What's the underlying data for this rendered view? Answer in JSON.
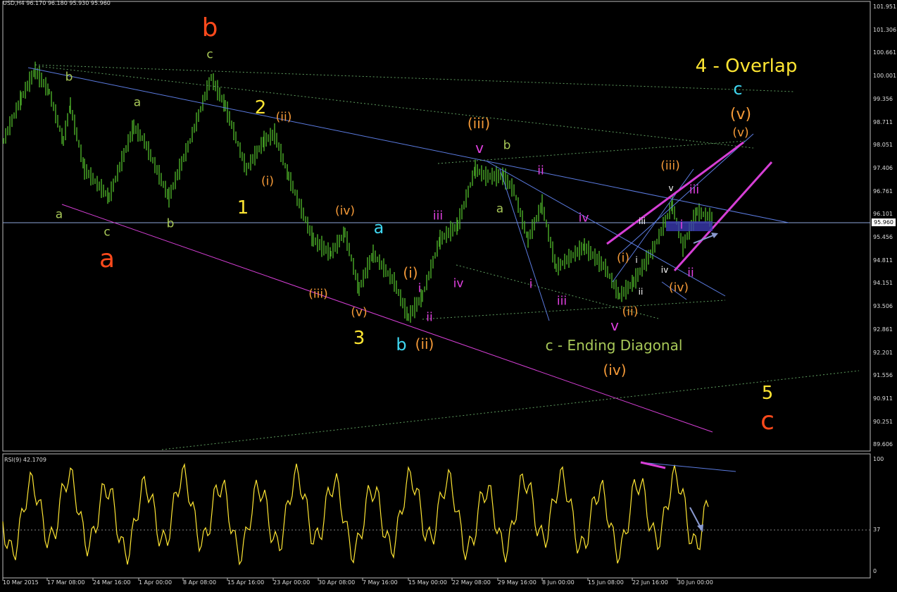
{
  "header": {
    "symbol_info": "USD,H4  96.170 96.180 95.930 95.960"
  },
  "current_price": "95.960",
  "price_axis": [
    "101.951",
    "101.306",
    "100.661",
    "100.001",
    "99.356",
    "98.711",
    "98.051",
    "97.406",
    "96.761",
    "96.101",
    "95.456",
    "94.811",
    "94.151",
    "93.506",
    "92.861",
    "92.201",
    "91.556",
    "90.911",
    "90.251",
    "89.606"
  ],
  "time_axis": [
    "10 Mar 2015",
    "17 Mar 08:00",
    "24 Mar 16:00",
    "1 Apr 00:00",
    "8 Apr 08:00",
    "15 Apr 16:00",
    "23 Apr 00:00",
    "30 Apr 08:00",
    "7 May 16:00",
    "15 May 00:00",
    "22 May 08:00",
    "29 May 16:00",
    "8 Jun 00:00",
    "15 Jun 08:00",
    "22 Jun 16:00",
    "30 Jun 00:00"
  ],
  "rsi": {
    "label": "RSI(9) 42.1709",
    "levels": [
      "100",
      "37",
      "0"
    ]
  },
  "colors": {
    "background": "#000000",
    "candles": "#4CAF28",
    "trend_blue": "#5B7BE0",
    "trend_magenta": "#D63FD6",
    "dotted_green": "#5E9C5E",
    "rsi_line": "#FFE633",
    "red": "#FF4A1C",
    "orange": "#F59A38",
    "yellow": "#FFE633",
    "cyan": "#3FD6F0",
    "pink": "#E040E0",
    "olive": "#A8C858",
    "white": "#FFFFFF"
  },
  "labels": [
    {
      "text": "b",
      "color": "red",
      "size": 36
    },
    {
      "text": "a",
      "color": "red",
      "size": 36
    },
    {
      "text": "c",
      "color": "red",
      "size": 36
    },
    {
      "text": "c",
      "color": "olive",
      "size": 17
    },
    {
      "text": "b",
      "color": "olive",
      "size": 17
    },
    {
      "text": "a",
      "color": "olive",
      "size": 17
    },
    {
      "text": "a",
      "color": "olive",
      "size": 17
    },
    {
      "text": "c",
      "color": "olive",
      "size": 17
    },
    {
      "text": "b",
      "color": "olive",
      "size": 17
    },
    {
      "text": "b",
      "color": "olive",
      "size": 17
    },
    {
      "text": "a",
      "color": "olive",
      "size": 17
    },
    {
      "text": "2",
      "color": "yellow",
      "size": 26
    },
    {
      "text": "1",
      "color": "yellow",
      "size": 26
    },
    {
      "text": "3",
      "color": "yellow",
      "size": 26
    },
    {
      "text": "5",
      "color": "yellow",
      "size": 26
    },
    {
      "text": "4 - Overlap",
      "color": "yellow",
      "size": 26
    },
    {
      "text": "a",
      "color": "cyan",
      "size": 24
    },
    {
      "text": "b",
      "color": "cyan",
      "size": 24
    },
    {
      "text": "c",
      "color": "cyan",
      "size": 24
    },
    {
      "text": "(ii)",
      "color": "orange",
      "size": 17
    },
    {
      "text": "(i)",
      "color": "orange",
      "size": 17
    },
    {
      "text": "(iv)",
      "color": "orange",
      "size": 17
    },
    {
      "text": "(iii)",
      "color": "orange",
      "size": 17
    },
    {
      "text": "(v)",
      "color": "orange",
      "size": 17
    },
    {
      "text": "(i)",
      "color": "orange",
      "size": 20
    },
    {
      "text": "(ii)",
      "color": "orange",
      "size": 20
    },
    {
      "text": "(iii)",
      "color": "orange",
      "size": 20
    },
    {
      "text": "(iv)",
      "color": "orange",
      "size": 20
    },
    {
      "text": "(v)",
      "color": "orange",
      "size": 22
    },
    {
      "text": "(v)",
      "color": "orange",
      "size": 17
    },
    {
      "text": "(iii)",
      "color": "orange",
      "size": 17
    },
    {
      "text": "(i)",
      "color": "orange",
      "size": 17
    },
    {
      "text": "(ii)",
      "color": "orange",
      "size": 17
    },
    {
      "text": "(iv)",
      "color": "orange",
      "size": 17
    },
    {
      "text": "iii",
      "color": "pink",
      "size": 17
    },
    {
      "text": "iv",
      "color": "pink",
      "size": 17
    },
    {
      "text": "i",
      "color": "pink",
      "size": 17
    },
    {
      "text": "ii",
      "color": "pink",
      "size": 17
    },
    {
      "text": "v",
      "color": "pink",
      "size": 20
    },
    {
      "text": "ii",
      "color": "pink",
      "size": 17
    },
    {
      "text": "iv",
      "color": "pink",
      "size": 17
    },
    {
      "text": "i",
      "color": "pink",
      "size": 17
    },
    {
      "text": "iii",
      "color": "pink",
      "size": 17
    },
    {
      "text": "v",
      "color": "pink",
      "size": 20
    },
    {
      "text": "iii",
      "color": "pink",
      "size": 17
    },
    {
      "text": "i",
      "color": "pink",
      "size": 17
    },
    {
      "text": "ii",
      "color": "pink",
      "size": 17
    },
    {
      "text": "iii",
      "color": "white",
      "size": 12
    },
    {
      "text": "i",
      "color": "white",
      "size": 12
    },
    {
      "text": "ii",
      "color": "white",
      "size": 12
    },
    {
      "text": "iv",
      "color": "white",
      "size": 12
    },
    {
      "text": "v",
      "color": "white",
      "size": 12
    },
    {
      "text": "c - Ending Diagonal",
      "color": "olive",
      "size": 20
    }
  ]
}
